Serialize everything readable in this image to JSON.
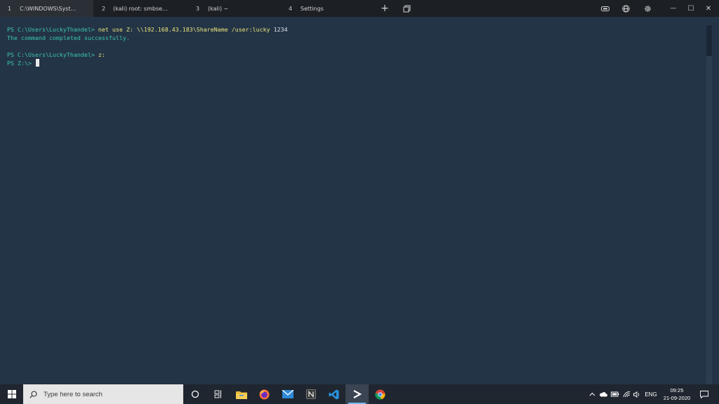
{
  "tabs": [
    {
      "number": "1",
      "title": "C:\\WINDOWS\\Syst…",
      "active": true
    },
    {
      "number": "2",
      "title": "(kali) root: smbse…",
      "active": false
    },
    {
      "number": "3",
      "title": "(kali) ~",
      "active": false
    },
    {
      "number": "4",
      "title": "Settings",
      "active": false
    }
  ],
  "tabbar_icons": {
    "new_tab": "+",
    "new_tab_icon": "plus-icon",
    "window_switch_icon": "overlapping-windows-icon",
    "pill_icon": "key-icon",
    "globe_icon": "globe-icon",
    "settings_icon": "gear-icon",
    "minimize": "—",
    "maximize": "☐",
    "close": "✕"
  },
  "terminal": {
    "lines": [
      {
        "prompt": "PS C:\\Users\\LuckyThandel> ",
        "command": "net use ",
        "args": "Z: \\\\192.168.43.183\\ShareName /user:lucky ",
        "value": "1234"
      },
      {
        "output": "The command completed successfully."
      },
      {
        "prompt": "PS C:\\Users\\LuckyThandel> ",
        "command": "z:"
      },
      {
        "prompt": "PS Z:\\> "
      }
    ],
    "colors": {
      "background": "#243447",
      "prompt": "#39c6b0",
      "command": "#e8e27a",
      "text": "#dfe3e8"
    }
  },
  "taskbar": {
    "search_placeholder": "Type here to search",
    "apps": [
      "task-view-icon",
      "timeline-icon",
      "file-explorer-icon",
      "firefox-icon",
      "mail-icon",
      "notion-icon",
      "vscode-icon",
      "terminal-icon",
      "chrome-icon"
    ],
    "tray": {
      "language": "ENG",
      "time": "09:25",
      "date": "21-09-2020"
    }
  }
}
